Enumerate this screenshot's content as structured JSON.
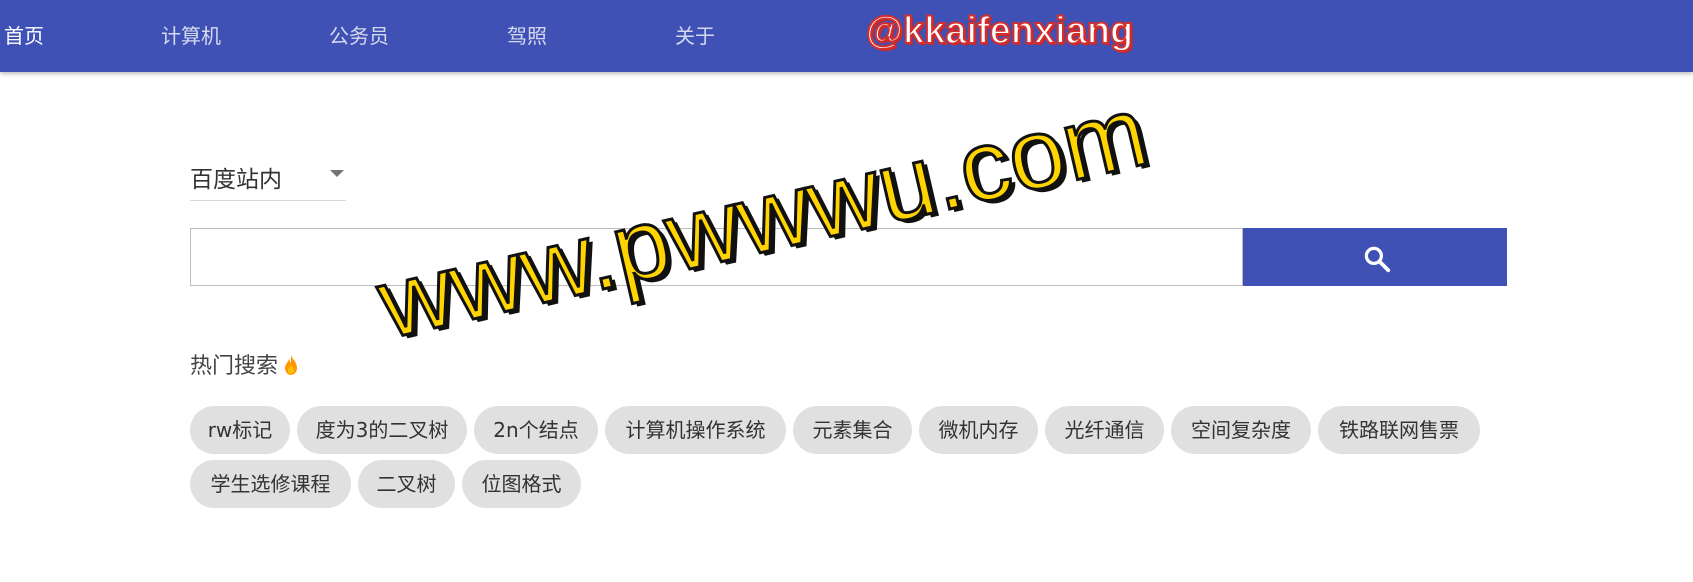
{
  "nav": {
    "items": [
      {
        "label": "首页",
        "active": true
      },
      {
        "label": "计算机",
        "active": false
      },
      {
        "label": "公务员",
        "active": false
      },
      {
        "label": "驾照",
        "active": false
      },
      {
        "label": "关于",
        "active": false
      }
    ],
    "handle": "@kkaifenxiang"
  },
  "search": {
    "engine_selected": "百度站内",
    "query": "",
    "button_icon": "search-icon"
  },
  "hot": {
    "title": "热门搜索",
    "title_icon": "fire-icon",
    "tags": [
      "rw标记",
      "度为3的二叉树",
      "2n个结点",
      "计算机操作系统",
      "元素集合",
      "微机内存",
      "光纤通信",
      "空间复杂度",
      "铁路联网售票",
      "学生选修课程",
      "二叉树",
      "位图格式"
    ]
  },
  "watermark": "www.pwwwu.com",
  "colors": {
    "primary": "#3f51b5",
    "chip": "#e0e0e0",
    "watermark_fill": "#ffd400"
  }
}
